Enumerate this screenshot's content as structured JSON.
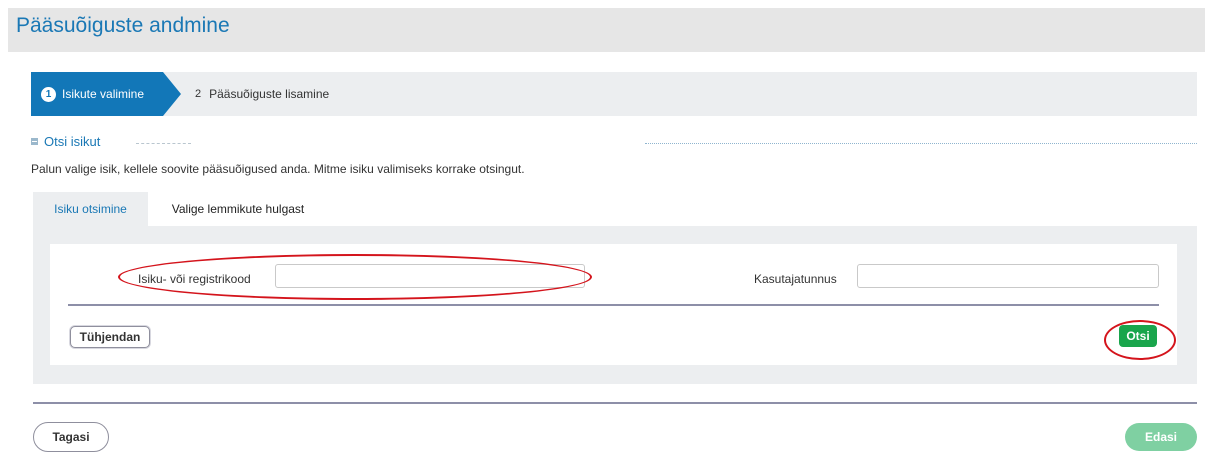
{
  "page": {
    "title": "Pääsuõiguste andmine"
  },
  "wizard": {
    "steps": [
      {
        "number": "1",
        "label": "Isikute valimine",
        "active": true
      },
      {
        "number": "2",
        "label": "Pääsuõiguste lisamine",
        "active": false
      }
    ]
  },
  "section": {
    "title": "Otsi isikut",
    "instruction": "Palun valige isik, kellele soovite pääsuõigused anda. Mitme isiku valimiseks korrake otsingut."
  },
  "tabs": [
    {
      "label": "Isiku otsimine",
      "active": true
    },
    {
      "label": "Valige lemmikute hulgast",
      "active": false
    }
  ],
  "search": {
    "id_label": "Isiku- või registrikood",
    "id_value": "",
    "username_label": "Kasutajatunnus",
    "username_value": "",
    "clear_label": "Tühjendan",
    "search_label": "Otsi"
  },
  "footer": {
    "back_label": "Tagasi",
    "next_label": "Edasi"
  },
  "colors": {
    "accent": "#1277b8",
    "title": "#1a78b5",
    "primary_button": "#19a54c",
    "disabled_button": "#7fd0a2",
    "annotation": "#d4141c"
  }
}
